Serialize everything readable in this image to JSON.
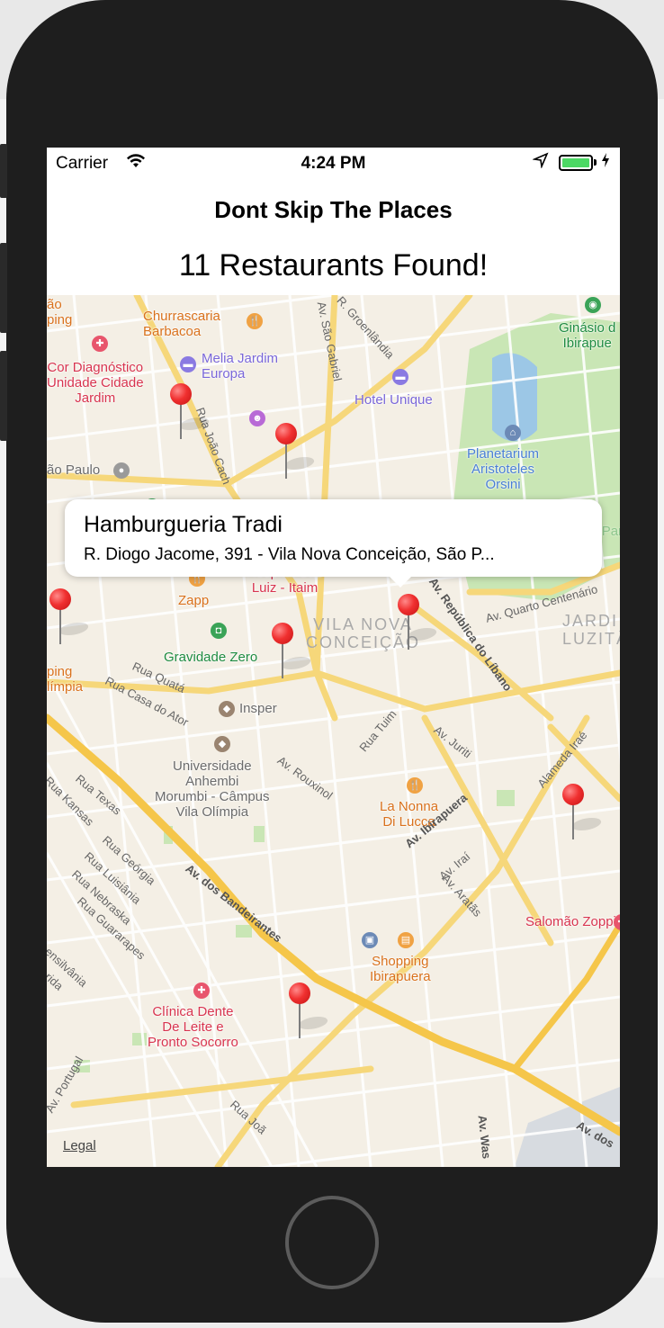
{
  "status_bar": {
    "carrier": "Carrier",
    "time": "4:24 PM"
  },
  "app": {
    "title": "Dont Skip The Places",
    "restaurants_found": "11 Restaurants Found!"
  },
  "callout": {
    "title": "Hamburgueria Tradi",
    "subtitle": "R. Diogo Jacome, 391 - Vila Nova Conceição, São P..."
  },
  "map": {
    "legal": "Legal",
    "poi_labels": {
      "churrascaria": "Churrascaria\nBarbacoa",
      "cor_diagnostico": "Cor Diagnóstico\nUnidade Cidade\nJardim",
      "melia": "Melia Jardim\nEuropa",
      "hotel_unique": "Hotel Unique",
      "ginasio": "Ginásio d\nIbirapue",
      "planetarium": "Planetarium\nAristoteles\nOrsini",
      "sao_paulo": "ão Paulo",
      "sao_top": "ão\nping",
      "hospital": "Hospital São\nLuiz - Itaim",
      "zapp": "Zapp",
      "gravidade": "Gravidade Zero",
      "insper": "Insper",
      "universidade": "Universidade\nAnhembi\nMorumbi - Câmpus\nVila Olímpia",
      "shopping_olimpia": "ping\nlímpia",
      "la_nonna": "La Nonna\nDi Lucca",
      "salomao": "Salomão Zoppi",
      "shopping_ibirapuera": "Shopping\nIbirapuera",
      "clinica": "Clínica Dente\nDe Leite e\nPronto Socorro",
      "ibirapuera_park": "Ibirapuera Park"
    },
    "districts": {
      "vila_nova": "VILA NOVA\nCONCEIÇÃO",
      "jardim": "JARDI\nLUZITÂ"
    },
    "streets": {
      "sao_gabriel": "Av. São Gabriel",
      "groenlandia": "R. Groenlândia",
      "rua_joao": "Rua João Cach",
      "republica": "Av. República do Líbano",
      "quarto_centenario": "Av. Quarto Centenário",
      "rua_quata": "Rua Quatá",
      "rua_casa": "Rua Casa do Ator",
      "rua_tuim": "Rua Tuim",
      "av_juriti": "Av. Juriti",
      "av_rouxinol": "Av. Rouxinol",
      "alameda_irae": "Alameda Iraé",
      "rua_texas": "Rua Texas",
      "rua_kansas": "Rua Kansas",
      "av_bandeirantes": "Av. dos Bandeirantes",
      "av_ibirapuera": "Av. Ibirapuera",
      "av_aratas": "Av. Aratãs",
      "av_irai": "Av. Iraí",
      "rua_georgia": "Rua Geórgia",
      "rua_luisiania": "Rua Luisiânia",
      "rua_nebraska": "Rua Nebraska",
      "rua_guararapes": "Rua Guararapes",
      "ensilvania": "ensilvânia",
      "rida": "rida",
      "av_portugal": "Av. Portugal",
      "rua_joa": "Rua Joã",
      "av_was": "Av. Was",
      "av_dos": "Av. dos"
    }
  }
}
